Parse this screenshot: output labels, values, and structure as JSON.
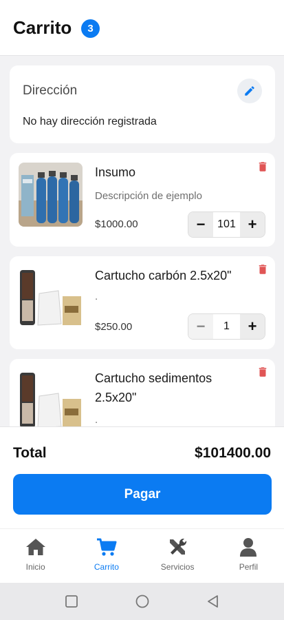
{
  "header": {
    "title": "Carrito",
    "badge_count": "3"
  },
  "address": {
    "title": "Dirección",
    "text": "No hay dirección registrada",
    "edit_icon": "pencil-icon"
  },
  "items": [
    {
      "name": "Insumo",
      "description": "Descripción de ejemplo",
      "price": "$1000.00",
      "quantity": "101"
    },
    {
      "name": "Cartucho carbón 2.5x20\"",
      "description": ".",
      "price": "$250.00",
      "quantity": "1"
    },
    {
      "name_line1": "Cartucho sedimentos",
      "name_line2": "2.5x20\"",
      "description": "."
    }
  ],
  "stepper": {
    "minus": "−",
    "plus": "+"
  },
  "summary": {
    "total_label": "Total",
    "total_value": "$101400.00",
    "pay_label": "Pagar"
  },
  "tabs": [
    {
      "label": "Inicio",
      "icon": "home-icon"
    },
    {
      "label": "Carrito",
      "icon": "cart-icon",
      "active": true
    },
    {
      "label": "Servicios",
      "icon": "tools-icon"
    },
    {
      "label": "Perfil",
      "icon": "user-icon"
    }
  ],
  "system_nav": [
    "square-recent-icon",
    "circle-home-icon",
    "triangle-back-icon"
  ],
  "colors": {
    "accent": "#0b7bf2",
    "danger": "#e05555",
    "background": "#f2f2f4"
  }
}
